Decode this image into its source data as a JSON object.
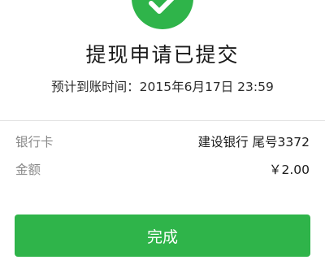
{
  "status": {
    "title": "提现申请已提交",
    "expected_arrival": "预计到账时间：2015年6月17日 23:59",
    "icon": "check-circle-icon"
  },
  "details": {
    "bank_card": {
      "label": "银行卡",
      "value": "建设银行 尾号3372"
    },
    "amount": {
      "label": "金额",
      "value": "￥2.00"
    }
  },
  "actions": {
    "done_label": "完成"
  },
  "colors": {
    "accent_green": "#2fb44a",
    "label_gray": "#8a8a8a",
    "divider": "#e2e2e2"
  }
}
